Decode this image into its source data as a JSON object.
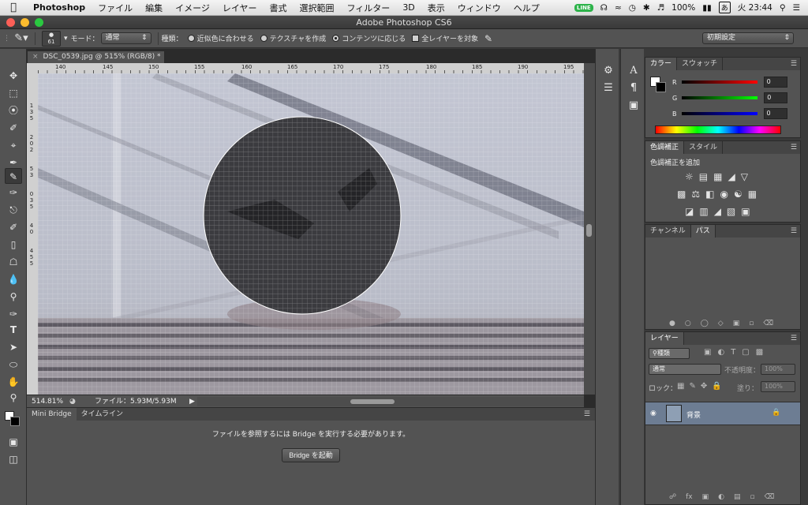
{
  "menubar": {
    "app_name": "Photoshop",
    "items": [
      "ファイル",
      "編集",
      "イメージ",
      "レイヤー",
      "書式",
      "選択範囲",
      "フィルター",
      "3D",
      "表示",
      "ウィンドウ",
      "ヘルプ"
    ],
    "status": {
      "line_badge": "LINE",
      "battery": "100%",
      "ime": "あ",
      "clock": "火 23:44"
    }
  },
  "window": {
    "title": "Adobe Photoshop CS6"
  },
  "options": {
    "brush_size": "61",
    "mode_label": "モード：",
    "mode_value": "通常",
    "type_label": "種類：",
    "radio_proximity": "近似色に合わせる",
    "radio_texture": "テクスチャを作成",
    "radio_content": "コンテンツに応じる",
    "check_all_layers": "全レイヤーを対象",
    "workspace": "初期設定"
  },
  "document": {
    "tab_label": "DSC_0539.jpg @ 515% (RGB/8) *",
    "ruler_ticks": [
      "140",
      "145",
      "150",
      "155",
      "160",
      "165",
      "170",
      "175",
      "180",
      "185",
      "190",
      "195"
    ],
    "ruler_left": [
      "1",
      "3",
      "5",
      "2",
      "0",
      "2",
      "5",
      "3",
      "0",
      "3",
      "5",
      "4",
      "0",
      "4",
      "5",
      "5"
    ],
    "zoom": "514.81%",
    "file_info": "ファイル：5.93M/5.93M"
  },
  "bridge": {
    "tabs": [
      "Mini Bridge",
      "タイムライン"
    ],
    "message": "ファイルを参照するには Bridge を実行する必要があります。",
    "launch_button": "Bridge を起動"
  },
  "color_panel": {
    "tabs": [
      "カラー",
      "スウォッチ"
    ],
    "r_label": "R",
    "g_label": "G",
    "b_label": "B",
    "r_value": "0",
    "g_value": "0",
    "b_value": "0"
  },
  "adjust_panel": {
    "tabs": [
      "色調補正",
      "スタイル"
    ],
    "heading": "色調補正を追加"
  },
  "paths_panel": {
    "tabs": [
      "チャンネル",
      "パス"
    ]
  },
  "layers_panel": {
    "tabs": [
      "レイヤー"
    ],
    "filter": "種類",
    "blend": "通常",
    "opacity_label": "不透明度：",
    "opacity_value": "100%",
    "lock_label": "ロック：",
    "fill_label": "塗り：",
    "fill_value": "100%",
    "layer_name": "背景"
  },
  "colors": {
    "panel": "#535353",
    "selected_layer": "#6d7d93",
    "bg": "#3a3a3a"
  }
}
